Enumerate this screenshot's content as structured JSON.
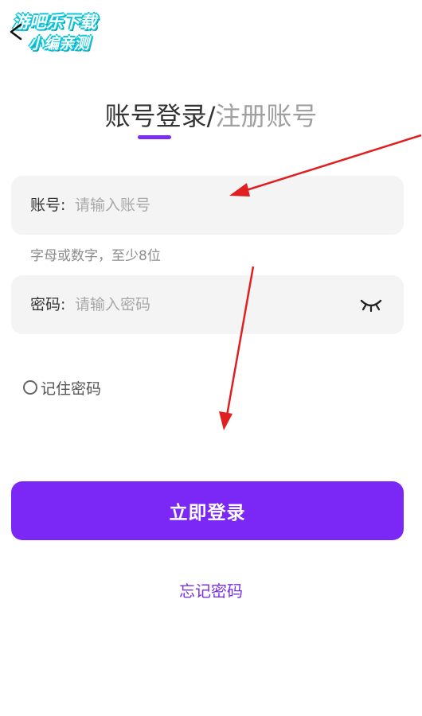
{
  "watermark": {
    "line1": "游吧乐下载",
    "line2": "小编亲测"
  },
  "header": {
    "active_tab": "账号登录",
    "separator": "/",
    "inactive_tab": "注册账号"
  },
  "account_field": {
    "label": "账号:",
    "placeholder": "请输入账号",
    "value": "",
    "hint": "字母或数字，至少8位"
  },
  "password_field": {
    "label": "密码:",
    "placeholder": "请输入密码",
    "value": "",
    "toggle_icon": "eye-closed-icon"
  },
  "remember": {
    "label": "记住密码",
    "checked": false
  },
  "login_button": {
    "label": "立即登录"
  },
  "forgot_link": {
    "label": "忘记密码"
  },
  "colors": {
    "accent": "#7b28f6",
    "field_bg": "#f4f4f4",
    "annotation_arrow": "#e02020"
  }
}
